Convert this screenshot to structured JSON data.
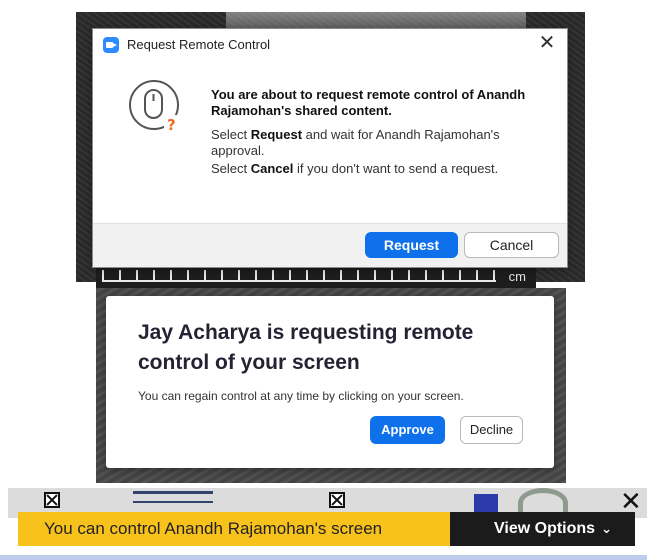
{
  "dialog_request": {
    "title": "Request Remote Control",
    "message_bold": "You are about to request remote control of Anandh Rajamohan's shared content.",
    "line1_prefix": "Select ",
    "line1_strong": "Request",
    "line1_suffix": " and wait for Anandh Rajamohan's approval.",
    "line2_prefix": "Select ",
    "line2_strong": "Cancel",
    "line2_suffix": " if you don't want to send a request.",
    "request_label": "Request",
    "cancel_label": "Cancel",
    "close_glyph": "✕",
    "icon": "mouse-question-icon"
  },
  "ruler": {
    "unit": "cm"
  },
  "dialog_incoming": {
    "heading": "Jay Acharya is requesting remote control of your screen",
    "subtext": "You can regain control at any time by clicking on your screen.",
    "approve_label": "Approve",
    "decline_label": "Decline"
  },
  "control_bar": {
    "banner_text": "You can control Anandh Rajamohan's screen",
    "view_options_label": "View Options",
    "chevron": "⌄"
  },
  "colors": {
    "primary_blue": "#0e71eb",
    "banner_yellow": "#f8c21d",
    "toolbar_dark": "#1b1b1b",
    "zoom_blue": "#2d8cff",
    "warning_orange": "#f06b25"
  }
}
